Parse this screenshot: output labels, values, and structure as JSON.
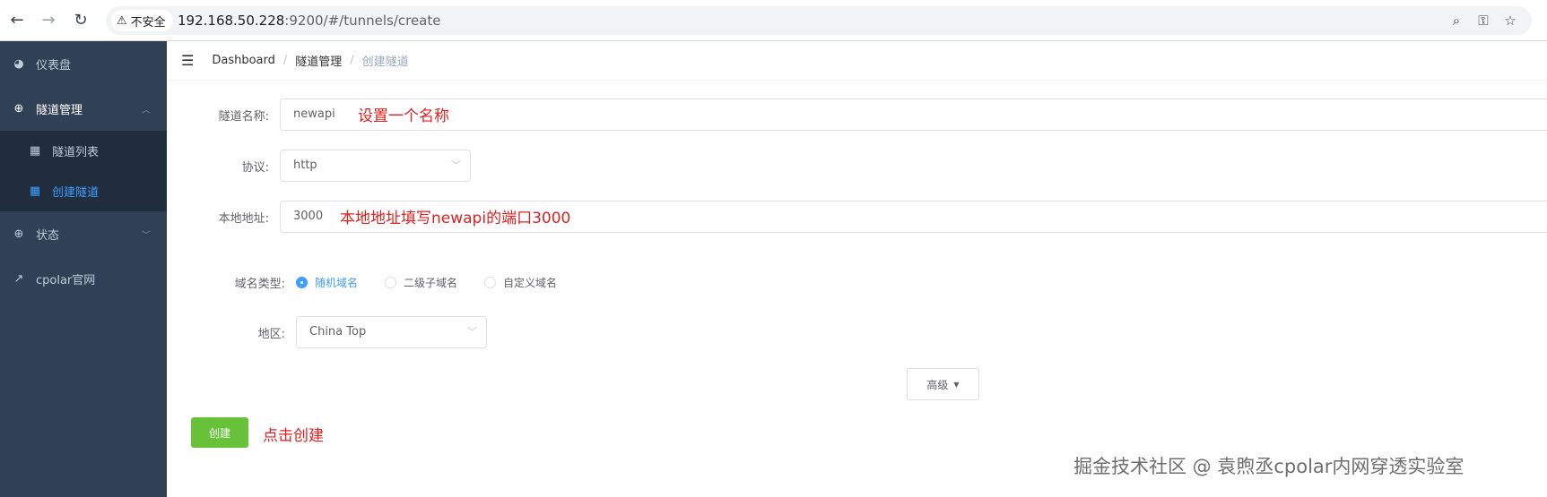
{
  "browser": {
    "security_label": "不安全",
    "url_host": "192.168.50.228",
    "url_rest": ":9200/#/tunnels/create"
  },
  "sidebar": {
    "items": [
      {
        "label": "仪表盘",
        "icon": "dashboard-icon"
      },
      {
        "label": "隧道管理",
        "icon": "plus-circle-icon"
      },
      {
        "label": "状态",
        "icon": "plus-circle-icon"
      },
      {
        "label": "cpolar官网",
        "icon": "external-link-icon"
      }
    ],
    "sub_items": [
      {
        "label": "隧道列表",
        "icon": "grid-icon"
      },
      {
        "label": "创建隧道",
        "icon": "grid-icon"
      }
    ],
    "active_color": "#409eff"
  },
  "breadcrumb": [
    "Dashboard",
    "隧道管理",
    "创建隧道"
  ],
  "form": {
    "name_label": "隧道名称:",
    "name_value": "newapi",
    "protocol_label": "协议:",
    "protocol_value": "http",
    "local_label": "本地地址:",
    "local_value": "3000",
    "domain_type_label": "域名类型:",
    "domain_types": [
      "随机域名",
      "二级子域名",
      "自定义域名"
    ],
    "domain_type_selected": "随机域名",
    "region_label": "地区:",
    "region_value": "China Top",
    "advanced_label": "高级",
    "create_label": "创建"
  },
  "annotations": {
    "name_note": "设置一个名称",
    "local_note": "本地地址填写newapi的端口3000",
    "create_note": "点击创建"
  },
  "watermark": "掘金技术社区 @ 袁煦丞cpolar内网穿透实验室",
  "colors": {
    "sidebar_bg": "#304156",
    "submenu_bg": "#1f2d3d",
    "primary": "#409eff",
    "success": "#67c23a",
    "annotation": "#e02020"
  }
}
